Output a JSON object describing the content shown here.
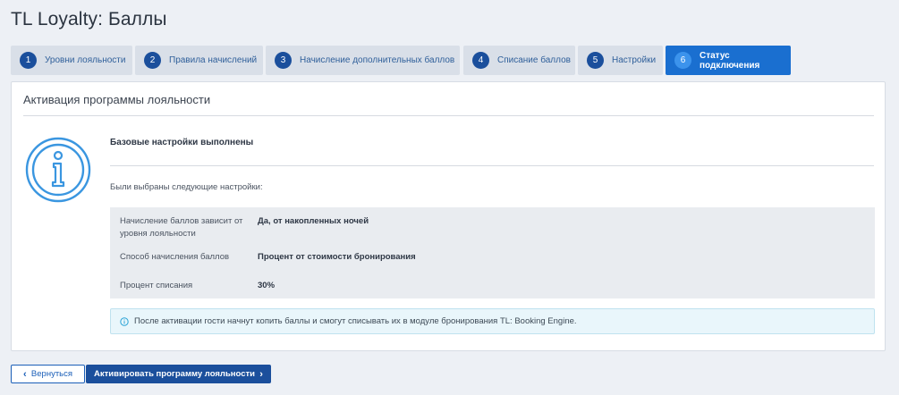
{
  "page": {
    "title": "TL Loyalty: Баллы"
  },
  "tabs": [
    {
      "num": "1",
      "label": "Уровни лояльности"
    },
    {
      "num": "2",
      "label": "Правила начислений"
    },
    {
      "num": "3",
      "label": "Начисление дополнительных баллов"
    },
    {
      "num": "4",
      "label": "Списание баллов"
    },
    {
      "num": "5",
      "label": "Настройки"
    },
    {
      "num": "6",
      "label": "Статус подключения",
      "active": true
    }
  ],
  "card": {
    "title": "Активация программы лояльности",
    "icon": "info-icon",
    "subtitle": "Базовые настройки выполнены",
    "chosen_label": "Были выбраны следующие настройки:",
    "settings": [
      {
        "label": "Начисление баллов зависит от уровня лояльности",
        "value": "Да, от накопленных ночей"
      },
      {
        "label": "Способ начисления баллов",
        "value": "Процент от стоимости бронирования"
      },
      {
        "label": "Процент списания",
        "value": "30%"
      }
    ],
    "notice": "После активации гости начнут копить баллы и смогут списывать их в модуле бронирования TL: Booking Engine."
  },
  "actions": {
    "back_label": "Вернуться",
    "activate_label": "Активировать программу лояльности"
  },
  "colors": {
    "background": "#edf0f5",
    "tab_active": "#1a6fd0",
    "tab_inactive": "#d9dfe8",
    "primary": "#1b4f9c",
    "icon_blue": "#3a96e0",
    "notice_bg": "#e9f6fb"
  }
}
